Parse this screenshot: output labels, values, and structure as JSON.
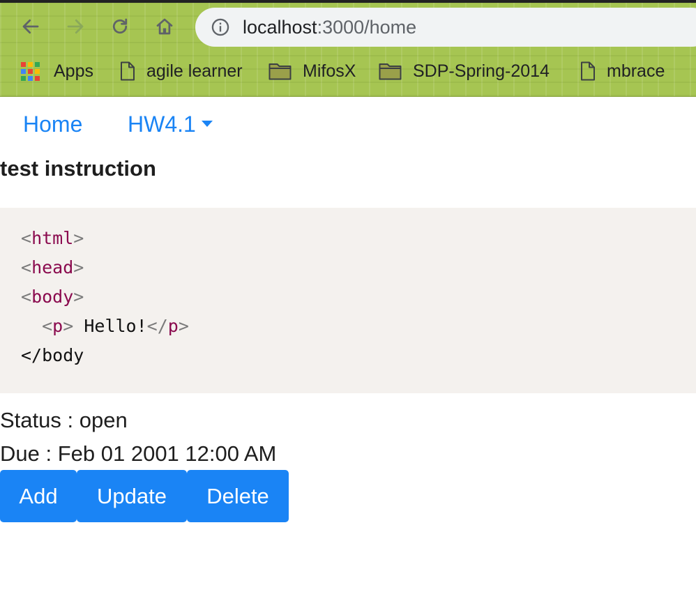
{
  "browser": {
    "url_host": "localhost",
    "url_rest": ":3000/home",
    "bookmarks": [
      {
        "label": "Apps",
        "icon": "apps-grid-icon"
      },
      {
        "label": "agile learner",
        "icon": "page-icon"
      },
      {
        "label": "MifosX",
        "icon": "folder-icon"
      },
      {
        "label": "SDP-Spring-2014",
        "icon": "folder-icon"
      },
      {
        "label": "mbrace",
        "icon": "page-icon"
      }
    ]
  },
  "nav": {
    "home_label": "Home",
    "dropdown_label": "HW4.1"
  },
  "assignment": {
    "title": "test instruction",
    "code": {
      "line1_tag": "html",
      "line2_tag": "head",
      "line3_tag": "body",
      "line4_open_tag": "p",
      "line4_text": " Hello!",
      "line4_close_tag": "p",
      "line5_text": "</body"
    },
    "status_text": "Status : open",
    "due_text": "Due : Feb 01 2001 12:00 AM"
  },
  "actions": {
    "add_label": "Add",
    "update_label": "Update",
    "delete_label": "Delete"
  },
  "colors": {
    "accent": "#1a84f5",
    "chrome_bg": "#a6c552",
    "code_bg": "#f4f1ee",
    "code_tag": "#8a0a4e"
  }
}
